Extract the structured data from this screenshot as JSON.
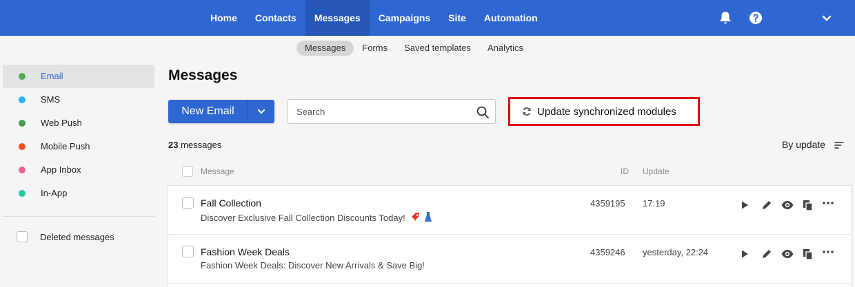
{
  "topnav": {
    "items": [
      {
        "label": "Home"
      },
      {
        "label": "Contacts"
      },
      {
        "label": "Messages"
      },
      {
        "label": "Campaigns"
      },
      {
        "label": "Site"
      },
      {
        "label": "Automation"
      }
    ],
    "active_index": 2,
    "icons": [
      "bell-icon",
      "help-icon",
      "chevron-down-icon"
    ]
  },
  "subnav": {
    "items": [
      {
        "label": "Messages"
      },
      {
        "label": "Forms"
      },
      {
        "label": "Saved templates"
      },
      {
        "label": "Analytics"
      }
    ],
    "active_index": 0
  },
  "sidebar": {
    "items": [
      {
        "label": "Email",
        "color": "#4caf50"
      },
      {
        "label": "SMS",
        "color": "#29b6f6"
      },
      {
        "label": "Web Push",
        "color": "#43a047"
      },
      {
        "label": "Mobile Push",
        "color": "#f4511e"
      },
      {
        "label": "App Inbox",
        "color": "#f06292"
      },
      {
        "label": "In-App",
        "color": "#26c6a6"
      }
    ],
    "active_index": 0,
    "deleted_label": "Deleted messages"
  },
  "main": {
    "title": "Messages",
    "new_button": "New Email",
    "search_placeholder": "Search",
    "update_button": "Update synchronized modules",
    "count_number": "23",
    "count_label": " messages",
    "sort_label": "By update",
    "columns": {
      "message": "Message",
      "id": "ID",
      "update": "Update"
    }
  },
  "rows": [
    {
      "name": "Fall Collection",
      "subject": "Discover Exclusive Fall Collection Discounts Today!",
      "subject_emoji": [
        "tag-emoji",
        "dress-emoji"
      ],
      "id": "4359195",
      "updated": "17:19"
    },
    {
      "name": "Fashion Week Deals",
      "subject": "Fashion Week Deals: Discover New Arrivals & Save Big!",
      "id": "4359246",
      "updated": "yesterday, 22:24"
    }
  ],
  "row_actions": [
    "play-icon",
    "edit-icon",
    "preview-icon",
    "copy-icon",
    "more-icon"
  ],
  "colors": {
    "brand_blue": "#2f67d2",
    "highlight_red": "#e3000f"
  }
}
